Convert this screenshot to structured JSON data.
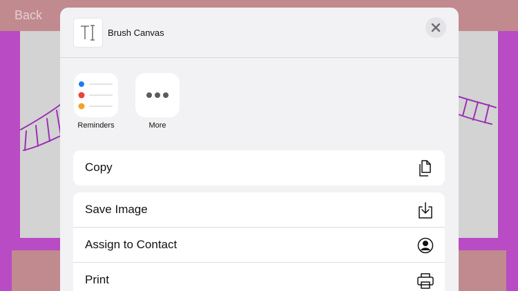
{
  "background": {
    "back_label": "Back",
    "colors": {
      "frame": "#b94bc4",
      "bars": "#c08a8e",
      "canvas": "#d3d3d3",
      "stroke": "#9b2fb5"
    }
  },
  "sheet": {
    "title": "Brush Canvas",
    "doc_icon": "text-cursor-icon",
    "close_icon": "close-icon",
    "apps": [
      {
        "label": "Reminders",
        "icon": "reminders-icon"
      },
      {
        "label": "More",
        "icon": "more-icon"
      }
    ],
    "actions_group_1": [
      {
        "label": "Copy",
        "icon": "copy-icon"
      }
    ],
    "actions_group_2": [
      {
        "label": "Save Image",
        "icon": "save-image-icon"
      },
      {
        "label": "Assign to Contact",
        "icon": "contact-icon"
      },
      {
        "label": "Print",
        "icon": "printer-icon"
      }
    ]
  }
}
